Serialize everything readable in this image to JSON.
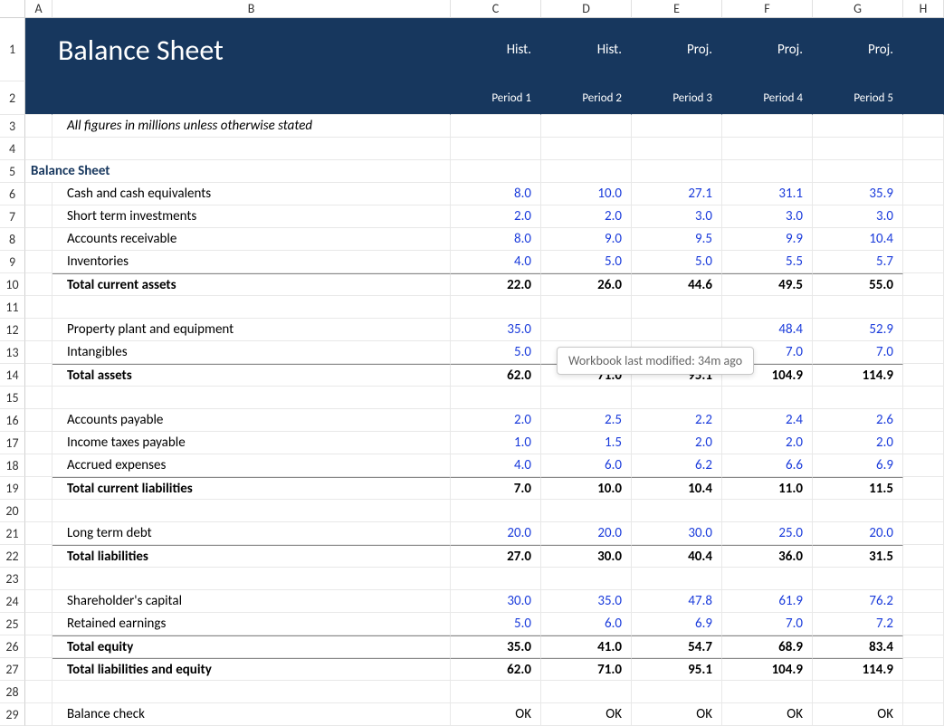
{
  "columns": [
    "A",
    "B",
    "C",
    "D",
    "E",
    "F",
    "G",
    "H"
  ],
  "rows_count": 29,
  "title": "Balance Sheet",
  "period_types": [
    "Hist.",
    "Hist.",
    "Proj.",
    "Proj.",
    "Proj."
  ],
  "period_labels": [
    "Period 1",
    "Period 2",
    "Period 3",
    "Period 4",
    "Period 5"
  ],
  "note": "All figures in millions unless otherwise stated",
  "section_heading": "Balance Sheet",
  "tooltip": "Workbook last modified: 34m ago",
  "lines": {
    "cash": {
      "label": "Cash and cash equivalents",
      "v": [
        "8.0",
        "10.0",
        "27.1",
        "31.1",
        "35.9"
      ]
    },
    "sti": {
      "label": "Short term investments",
      "v": [
        "2.0",
        "2.0",
        "3.0",
        "3.0",
        "3.0"
      ]
    },
    "ar": {
      "label": "Accounts receivable",
      "v": [
        "8.0",
        "9.0",
        "9.5",
        "9.9",
        "10.4"
      ]
    },
    "inv": {
      "label": "Inventories",
      "v": [
        "4.0",
        "5.0",
        "5.0",
        "5.5",
        "5.7"
      ]
    },
    "tca": {
      "label": "Total current assets",
      "v": [
        "22.0",
        "26.0",
        "44.6",
        "49.5",
        "55.0"
      ]
    },
    "ppe": {
      "label": "Property plant and equipment",
      "v": [
        "35.0",
        "",
        "",
        "48.4",
        "52.9"
      ]
    },
    "intan": {
      "label": "Intangibles",
      "v": [
        "5.0",
        "",
        "",
        "7.0",
        "7.0"
      ]
    },
    "ta": {
      "label": "Total assets",
      "v": [
        "62.0",
        "71.0",
        "95.1",
        "104.9",
        "114.9"
      ]
    },
    "ap": {
      "label": "Accounts payable",
      "v": [
        "2.0",
        "2.5",
        "2.2",
        "2.4",
        "2.6"
      ]
    },
    "itp": {
      "label": "Income taxes payable",
      "v": [
        "1.0",
        "1.5",
        "2.0",
        "2.0",
        "2.0"
      ]
    },
    "ae": {
      "label": "Accrued expenses",
      "v": [
        "4.0",
        "6.0",
        "6.2",
        "6.6",
        "6.9"
      ]
    },
    "tcl": {
      "label": "Total current liabilities",
      "v": [
        "7.0",
        "10.0",
        "10.4",
        "11.0",
        "11.5"
      ]
    },
    "ltd": {
      "label": "Long term debt",
      "v": [
        "20.0",
        "20.0",
        "30.0",
        "25.0",
        "20.0"
      ]
    },
    "tl": {
      "label": "Total liabilities",
      "v": [
        "27.0",
        "30.0",
        "40.4",
        "36.0",
        "31.5"
      ]
    },
    "sc": {
      "label": "Shareholder's capital",
      "v": [
        "30.0",
        "35.0",
        "47.8",
        "61.9",
        "76.2"
      ]
    },
    "re": {
      "label": "Retained earnings",
      "v": [
        "5.0",
        "6.0",
        "6.9",
        "7.0",
        "7.2"
      ]
    },
    "te": {
      "label": "Total equity",
      "v": [
        "35.0",
        "41.0",
        "54.7",
        "68.9",
        "83.4"
      ]
    },
    "tle": {
      "label": "Total liabilities and equity",
      "v": [
        "62.0",
        "71.0",
        "95.1",
        "104.9",
        "114.9"
      ]
    },
    "bc": {
      "label": "Balance check",
      "v": [
        "OK",
        "OK",
        "OK",
        "OK",
        "OK"
      ]
    }
  }
}
